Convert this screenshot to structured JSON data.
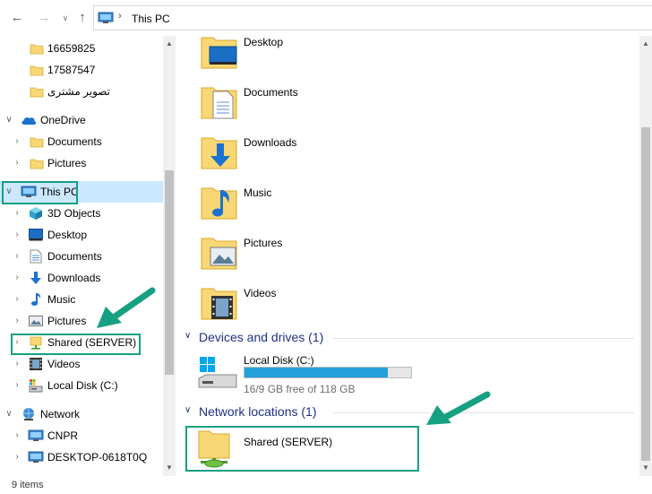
{
  "address_bar": {
    "crumb": "This PC"
  },
  "sidebar": {
    "items": [
      {
        "label": "16659825",
        "icon": "folder-icon"
      },
      {
        "label": "17587547",
        "icon": "folder-icon"
      },
      {
        "label": "تصویر مشتری",
        "icon": "folder-icon"
      },
      {
        "label": "OneDrive",
        "icon": "cloud-icon"
      },
      {
        "label": "Documents",
        "icon": "folder-icon"
      },
      {
        "label": "Pictures",
        "icon": "folder-icon"
      },
      {
        "label": "This PC",
        "icon": "computer-icon"
      },
      {
        "label": "3D Objects",
        "icon": "cube-icon"
      },
      {
        "label": "Desktop",
        "icon": "desktop-icon"
      },
      {
        "label": "Documents",
        "icon": "documents-icon"
      },
      {
        "label": "Downloads",
        "icon": "download-icon"
      },
      {
        "label": "Music",
        "icon": "music-icon"
      },
      {
        "label": "Pictures",
        "icon": "pictures-icon"
      },
      {
        "label": "Shared (SERVER)",
        "icon": "network-drive-icon"
      },
      {
        "label": "Videos",
        "icon": "videos-icon"
      },
      {
        "label": "Local Disk (C:)",
        "icon": "disk-icon"
      },
      {
        "label": "Network",
        "icon": "network-icon"
      },
      {
        "label": "CNPR",
        "icon": "computer-icon"
      },
      {
        "label": "DESKTOP-0618T0Q",
        "icon": "computer-icon"
      }
    ]
  },
  "content": {
    "folders": [
      {
        "label": "Desktop",
        "icon": "desktop-folder-icon"
      },
      {
        "label": "Documents",
        "icon": "documents-folder-icon"
      },
      {
        "label": "Downloads",
        "icon": "downloads-folder-icon"
      },
      {
        "label": "Music",
        "icon": "music-folder-icon"
      },
      {
        "label": "Pictures",
        "icon": "pictures-folder-icon"
      },
      {
        "label": "Videos",
        "icon": "videos-folder-icon"
      }
    ],
    "devices_header": "Devices and drives (1)",
    "drive": {
      "label": "Local Disk (C:)",
      "space_text": "16/9 GB free of 118 GB",
      "used_fraction": 0.86
    },
    "network_header": "Network locations (1)",
    "network_item": {
      "label": "Shared (SERVER)"
    }
  },
  "status": {
    "count": "9 items"
  },
  "colors": {
    "accent": "#15a082",
    "header_blue": "#1e3287",
    "selection": "#cce8ff",
    "drive_fill": "#26a0da"
  }
}
